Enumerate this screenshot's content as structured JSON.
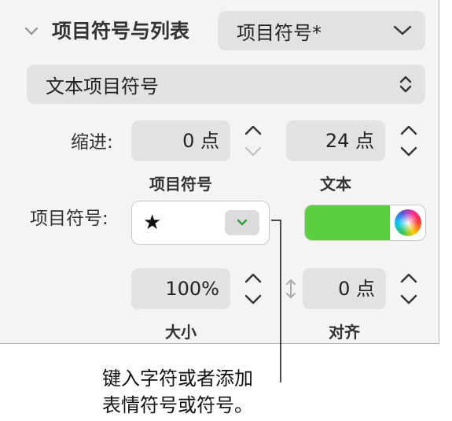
{
  "section": {
    "title": "项目符号与列表",
    "list_type": "项目符号*"
  },
  "bullet_style": "文本项目符号",
  "indent": {
    "label": "缩进:",
    "bullet_value": "0 点",
    "bullet_caption": "项目符号",
    "text_value": "24 点",
    "text_caption": "文本"
  },
  "bullet": {
    "label": "项目符号:",
    "symbol": "★",
    "color": "#5ad03f"
  },
  "size": {
    "value": "100%",
    "caption": "大小"
  },
  "align": {
    "value": "0 点",
    "caption": "对齐"
  },
  "callout": {
    "line1": "键入字符或者添加",
    "line2": "表情符号或符号。"
  },
  "colors": {
    "panel_bg": "#f4f4f4",
    "control_bg": "#e2e2e2",
    "swatch": "#5ad03f"
  }
}
